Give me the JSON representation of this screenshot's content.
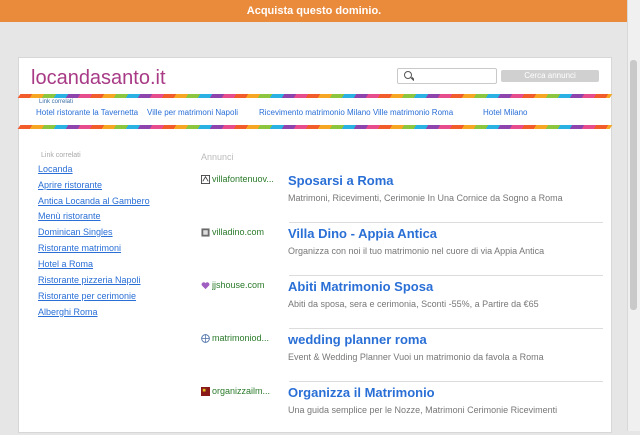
{
  "topbar": {
    "text": "Acquista questo dominio."
  },
  "header": {
    "logo": "locandasanto.it",
    "search_placeholder": "",
    "search_button": "Cerca annunci"
  },
  "related_bar": {
    "label": "Link correlati",
    "links": [
      "Hotel ristorante la Tavernetta",
      "Ville per matrimoni Napoli",
      "Ricevimento matrimonio Milano Ville matrimonio Roma",
      "Hotel Milano"
    ]
  },
  "sidebar": {
    "label": "Link correlati",
    "links": [
      "Locanda",
      "Aprire ristorante",
      "Antica Locanda al Gambero",
      "Menù ristorante",
      "Dominican Singles",
      "Ristorante matrimoni",
      "Hotel a Roma",
      "Ristorante pizzeria Napoli",
      "Ristorante per cerimonie",
      "Alberghi Roma"
    ]
  },
  "ads": {
    "label": "Annunci",
    "items": [
      {
        "icon": "villa-favicon",
        "icon_color": "#444444",
        "domain": "villafontenuov...",
        "title": "Sposarsi a Roma",
        "desc": "Matrimoni, Ricevimenti, Cerimonie In Una Cornice da Sogno a Roma"
      },
      {
        "icon": "page-favicon",
        "icon_color": "#6a6a6a",
        "domain": "villadino.com",
        "title": "Villa Dino - Appia Antica",
        "desc": "Organizza con noi il tuo matrimonio nel cuore di via Appia Antica"
      },
      {
        "icon": "heart-favicon",
        "icon_color": "#a05fc0",
        "domain": "jjshouse.com",
        "title": "Abiti Matrimonio Sposa",
        "desc": "Abiti da sposa, sera e cerimonia, Sconti -55%, a Partire da €65"
      },
      {
        "icon": "globe-favicon",
        "icon_color": "#4a6fa5",
        "domain": "matrimoniod...",
        "title": "wedding planner roma",
        "desc": "Event & Wedding Planner Vuoi un matrimonio da favola a Roma"
      },
      {
        "icon": "square-favicon",
        "icon_color": "#8a1a1a",
        "domain": "organizzailm...",
        "title": "Organizza il Matrimonio",
        "desc": "Una guida semplice per le Nozze, Matrimoni Cerimonie Ricevimenti"
      }
    ]
  }
}
